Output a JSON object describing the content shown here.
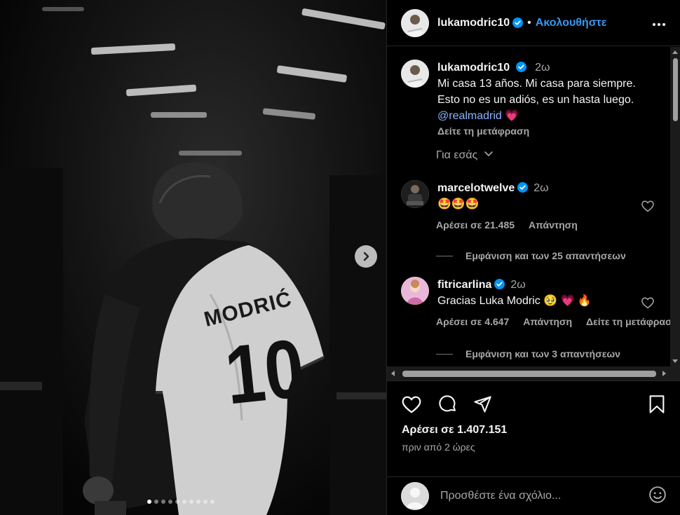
{
  "post": {
    "author": "lukamodric10",
    "follow_label": "Ακολουθήστε",
    "separator": "•",
    "media_dots_count": 10,
    "media_active_dot": 0
  },
  "caption": {
    "username": "lukamodric10",
    "time": "2ω",
    "line1": "Mi casa 13 años. Mi casa para siempre.",
    "line2": "Esto no es un adiós, es un hasta luego.",
    "mention": "@realmadrid",
    "emoji": "💗",
    "see_translation": "Δείτε τη μετάφραση"
  },
  "for_you": "Για εσάς",
  "comments": [
    {
      "username": "marcelotwelve",
      "time": "2ω",
      "text": "🤩🤩🤩",
      "likes": "Αρέσει σε 21.485",
      "reply": "Απάντηση",
      "translate": "",
      "view_replies": "Εμφάνιση και των 25 απαντήσεων"
    },
    {
      "username": "fitricarlina",
      "time": "2ω",
      "text": "Gracias Luka Modric 🥹 💗 🔥",
      "likes": "Αρέσει σε 4.647",
      "reply": "Απάντηση",
      "translate": "Δείτε τη μετάφραση",
      "view_replies": "Εμφάνιση και των 3 απαντήσεων"
    }
  ],
  "footer": {
    "likes": "Αρέσει σε 1.407.151",
    "posted": "πριν από 2 ώρες",
    "comment_placeholder": "Προσθέστε ένα σχόλιο..."
  },
  "jersey": {
    "name": "MODRIĆ",
    "number": "10"
  },
  "colors": {
    "accent": "#3797f0",
    "verified": "#0095f6",
    "muted": "#a8a8a8",
    "divider": "#262626"
  },
  "icons": [
    "more-icon",
    "verified-icon",
    "chevron-down-icon",
    "heart-icon",
    "comment-icon",
    "share-icon",
    "bookmark-icon",
    "emoji-icon",
    "next-arrow-icon"
  ]
}
